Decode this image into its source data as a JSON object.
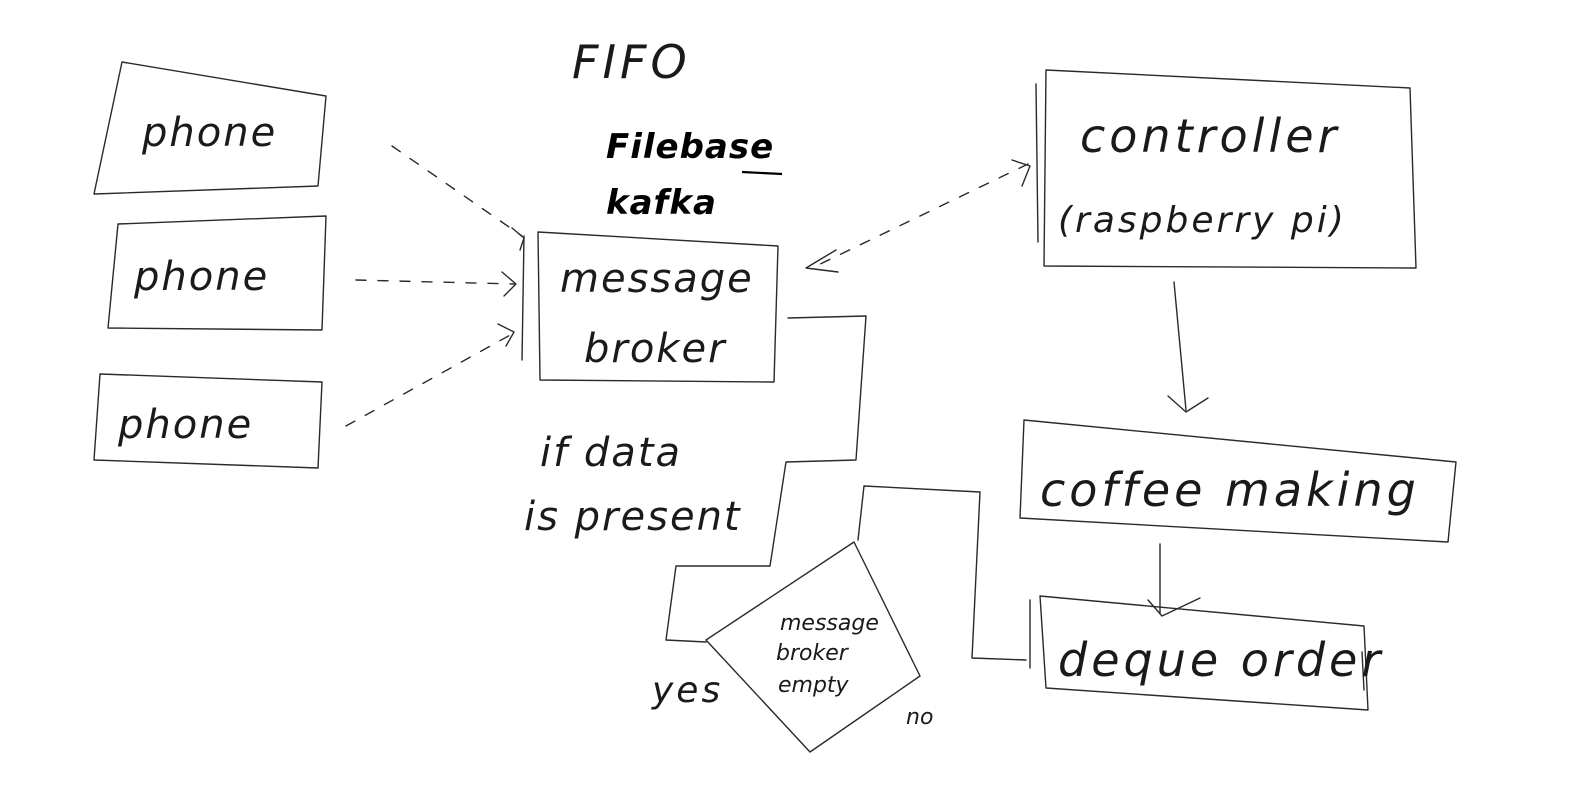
{
  "diagram": {
    "top_label": "FIFO",
    "technologies": [
      "Filebase",
      "kafka"
    ],
    "phones": [
      "phone",
      "phone",
      "phone"
    ],
    "message_broker": [
      "message",
      "broker"
    ],
    "controller": [
      "controller",
      "(raspberry pi)"
    ],
    "coffee_making": "coffee making",
    "deque_order": "deque order",
    "condition": [
      "if data",
      "is present"
    ],
    "decision": [
      "message",
      "broker",
      "empty"
    ],
    "yes_label": "yes",
    "no_label": "no"
  }
}
